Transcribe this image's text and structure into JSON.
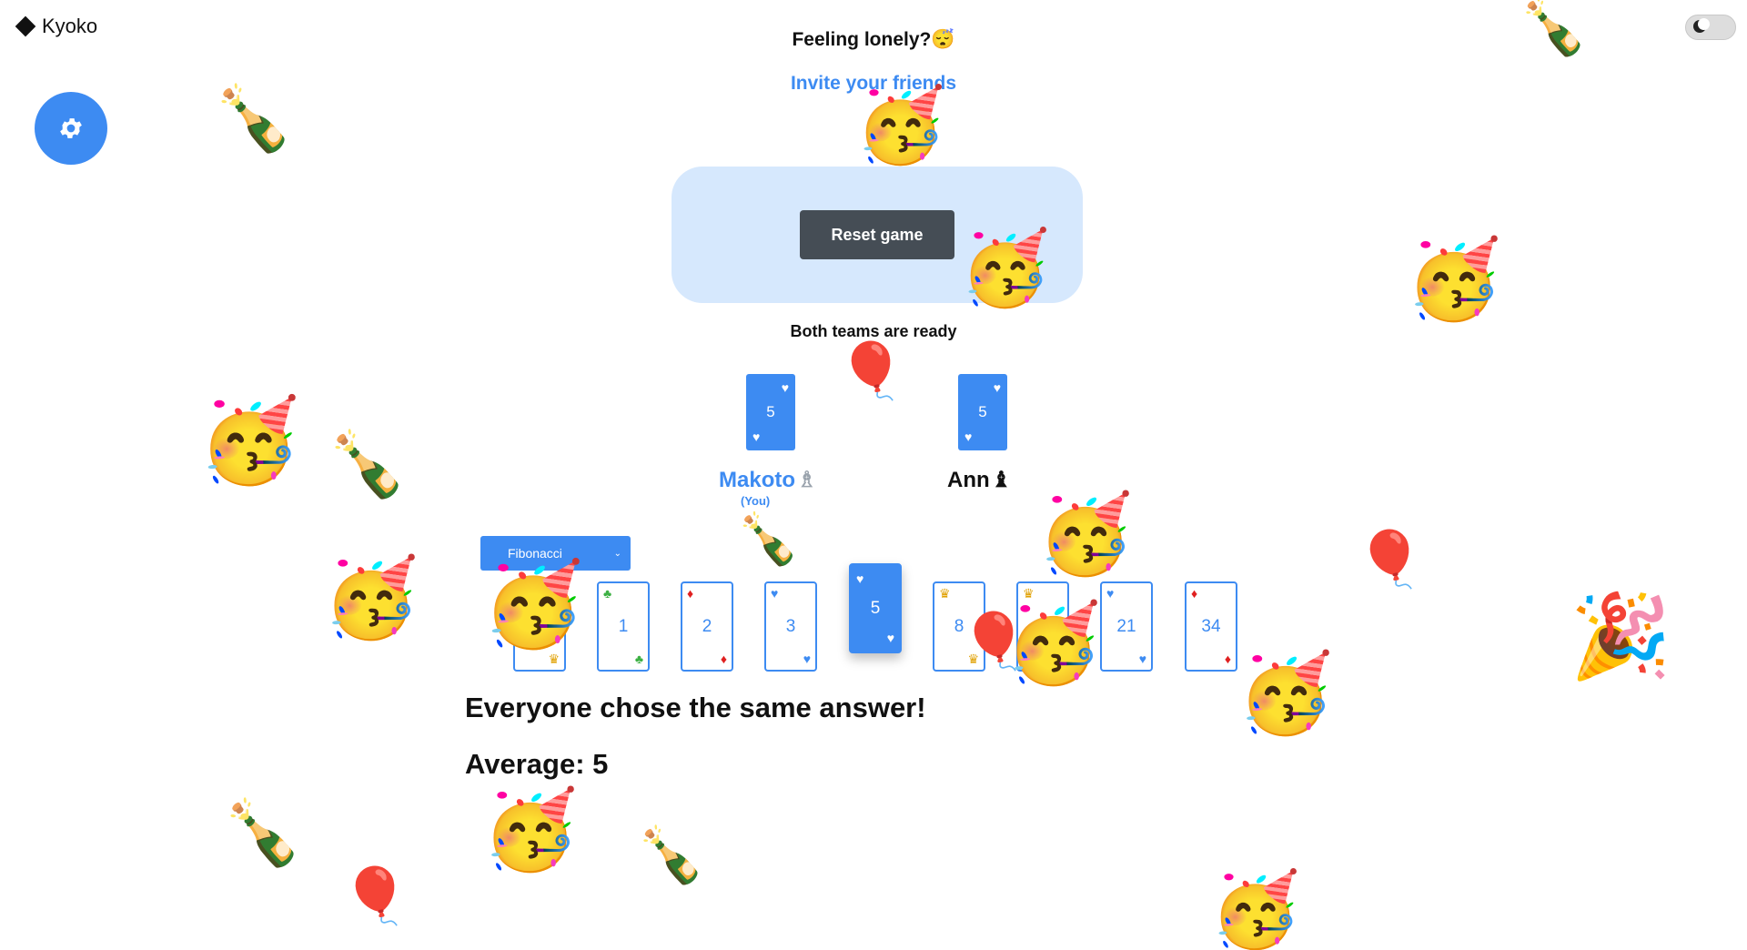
{
  "app": {
    "logo_text": "Kyoko"
  },
  "theme_toggle": {
    "icon": "moon-icon"
  },
  "settings": {
    "icon": "gear-icon"
  },
  "header": {
    "lonely_text": "Feeling lonely?😴",
    "invite_link": "Invite your friends"
  },
  "table": {
    "reset_label": "Reset game"
  },
  "status": "Both teams are ready",
  "players": [
    {
      "name": "Makoto",
      "badge": "♗",
      "you_label": "(You)",
      "card_value": "5",
      "card_suit": "♥"
    },
    {
      "name": "Ann",
      "badge": "♝",
      "card_value": "5",
      "card_suit": "♥"
    }
  ],
  "deck": {
    "selected_type": "Fibonacci",
    "cards": [
      {
        "value": "0",
        "suit": "♛",
        "suit_color": "#e0a000"
      },
      {
        "value": "1",
        "suit": "♣",
        "suit_color": "#3cb043"
      },
      {
        "value": "2",
        "suit": "♦",
        "suit_color": "#e02020"
      },
      {
        "value": "3",
        "suit": "♥",
        "suit_color": "#3d8bf2"
      },
      {
        "value": "5",
        "suit": "♥",
        "suit_color": "#ffffff",
        "selected": true
      },
      {
        "value": "8",
        "suit": "♛",
        "suit_color": "#e0a000"
      },
      {
        "value": "13",
        "suit": "♛",
        "suit_color": "#e0a000"
      },
      {
        "value": "21",
        "suit": "♥",
        "suit_color": "#3d8bf2"
      },
      {
        "value": "34",
        "suit": "♦",
        "suit_color": "#e02020"
      }
    ]
  },
  "results": {
    "message": "Everyone chose the same answer!",
    "average": "Average: 5"
  },
  "colors": {
    "accent": "#3d8bf2",
    "table_bg": "#d6e8fd",
    "button_dark": "#454d55"
  },
  "confetti": [
    "🥳",
    "🍾",
    "🎈",
    "🎉"
  ]
}
